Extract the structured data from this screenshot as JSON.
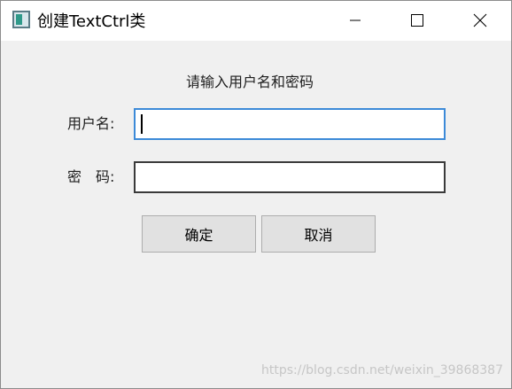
{
  "window": {
    "title": "创建TextCtrl类",
    "controls": {
      "minimize_icon": "minimize-icon",
      "maximize_icon": "maximize-icon",
      "close_icon": "close-icon"
    }
  },
  "form": {
    "heading": "请输入用户名和密码",
    "username_label": "用户名:",
    "username_value": "",
    "password_label": "密　码:",
    "password_value": ""
  },
  "buttons": {
    "ok_label": "确定",
    "cancel_label": "取消"
  },
  "watermark": "https://blog.csdn.net/weixin_39868387",
  "colors": {
    "background": "#f0f0f0",
    "focus_border": "#3c8ad8",
    "button_face": "#e1e1e1"
  }
}
